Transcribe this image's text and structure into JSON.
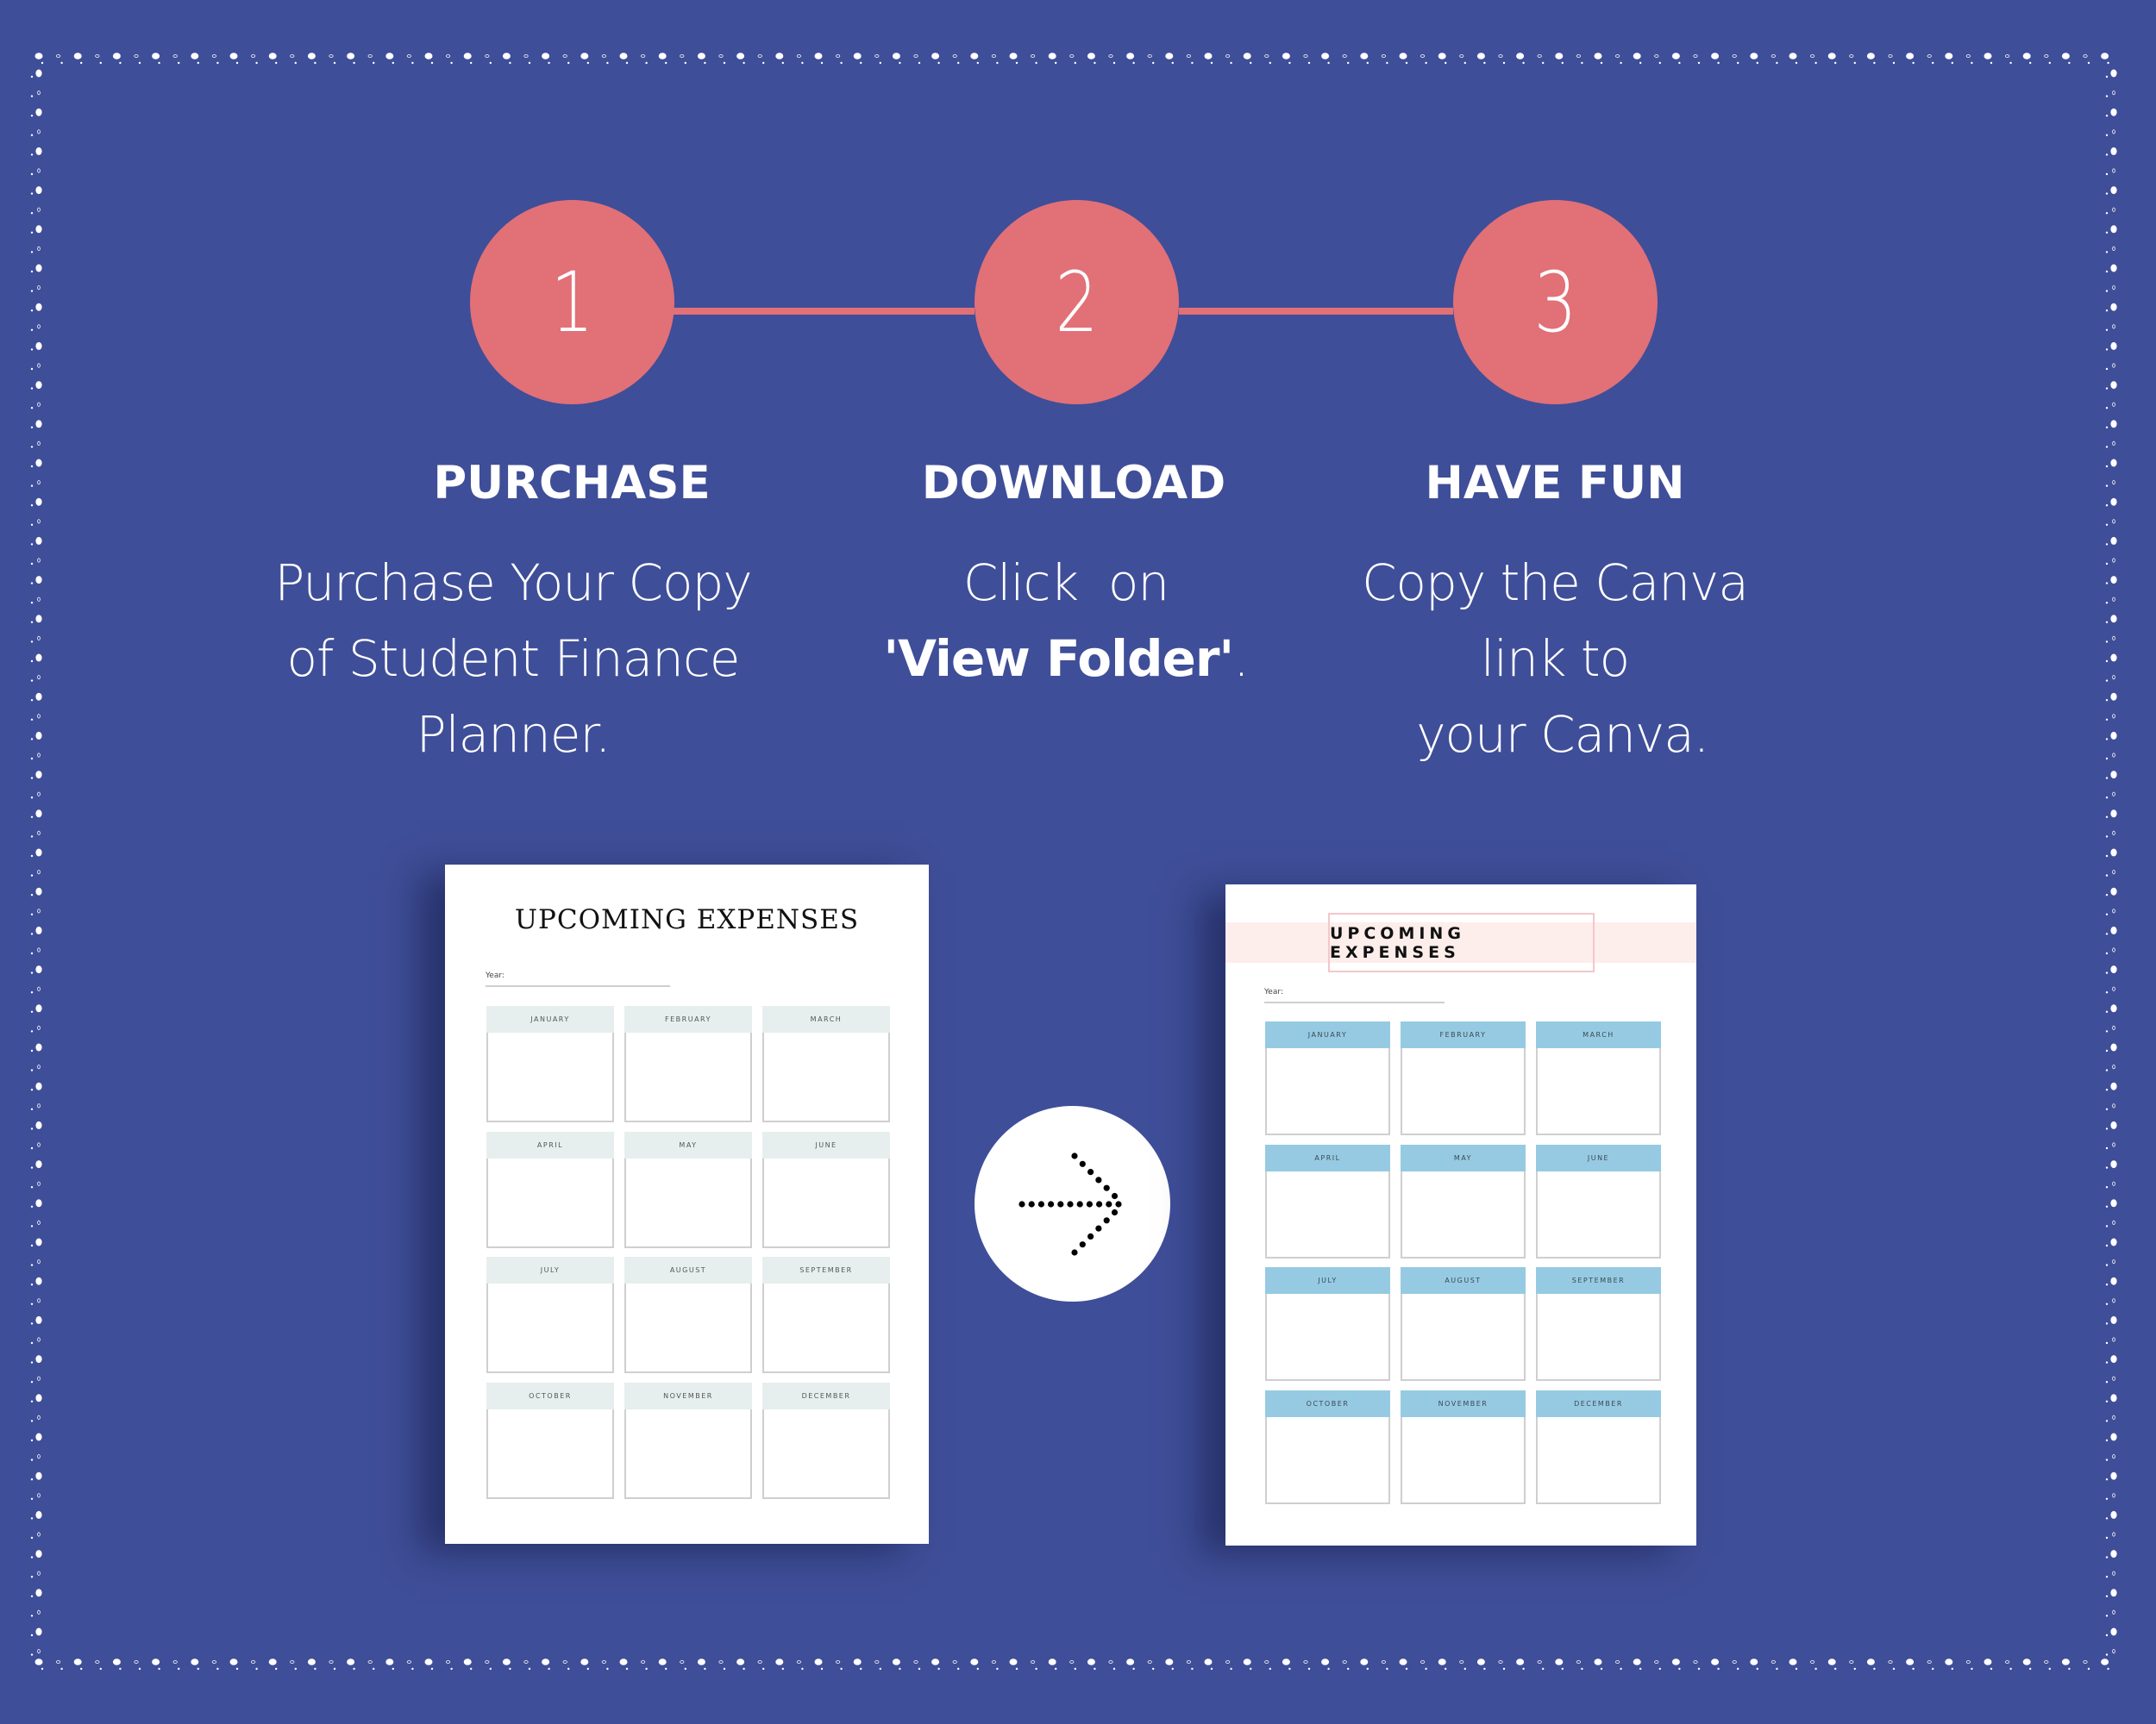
{
  "colors": {
    "background": "#3F4E98",
    "accent": "#E27077",
    "border_dots": "#FFFFFF",
    "doc_a_header": "#E6EEEE",
    "doc_b_header": "#96CAE2",
    "doc_b_band": "#FDEEEC",
    "doc_b_title_border": "#F5C6CA"
  },
  "steps": [
    {
      "number": "1",
      "title": "PURCHASE",
      "lines": [
        "Purchase Your Copy",
        "of Student Finance",
        "Planner."
      ]
    },
    {
      "number": "2",
      "title": "DOWNLOAD",
      "line1": "Click  on",
      "line2_bold": "'View Folder'",
      "line2_rest": "."
    },
    {
      "number": "3",
      "title": "HAVE FUN",
      "lines": [
        "Copy the Canva",
        "link to",
        " your Canva."
      ]
    }
  ],
  "arrow": {
    "icon": "dotted-arrow-right-icon"
  },
  "documents": [
    {
      "title": "UPCOMING EXPENSES",
      "year_label": "Year:",
      "months": [
        "JANUARY",
        "FEBRUARY",
        "MARCH",
        "APRIL",
        "MAY",
        "JUNE",
        "JULY",
        "AUGUST",
        "SEPTEMBER",
        "OCTOBER",
        "NOVEMBER",
        "DECEMBER"
      ]
    },
    {
      "title": "UPCOMING EXPENSES",
      "year_label": "Year:",
      "months": [
        "JANUARY",
        "FEBRUARY",
        "MARCH",
        "APRIL",
        "MAY",
        "JUNE",
        "JULY",
        "AUGUST",
        "SEPTEMBER",
        "OCTOBER",
        "NOVEMBER",
        "DECEMBER"
      ]
    }
  ]
}
